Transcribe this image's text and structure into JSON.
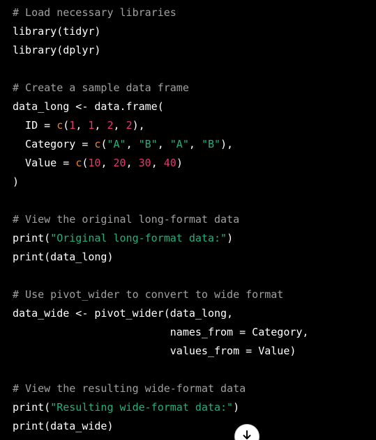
{
  "code_lines": [
    [
      {
        "t": "# Load necessary libraries",
        "k": "comment"
      }
    ],
    [
      {
        "t": "library(tidyr)",
        "k": "plain"
      }
    ],
    [
      {
        "t": "library(dplyr)",
        "k": "plain"
      }
    ],
    [],
    [
      {
        "t": "# Create a sample data frame",
        "k": "comment"
      }
    ],
    [
      {
        "t": "data_long <- data.frame(",
        "k": "plain"
      }
    ],
    [
      {
        "t": "  ID = ",
        "k": "plain"
      },
      {
        "t": "c",
        "k": "fn"
      },
      {
        "t": "(",
        "k": "plain"
      },
      {
        "t": "1",
        "k": "num"
      },
      {
        "t": ", ",
        "k": "plain"
      },
      {
        "t": "1",
        "k": "num"
      },
      {
        "t": ", ",
        "k": "plain"
      },
      {
        "t": "2",
        "k": "num"
      },
      {
        "t": ", ",
        "k": "plain"
      },
      {
        "t": "2",
        "k": "num"
      },
      {
        "t": "),",
        "k": "plain"
      }
    ],
    [
      {
        "t": "  Category = ",
        "k": "plain"
      },
      {
        "t": "c",
        "k": "fn"
      },
      {
        "t": "(",
        "k": "plain"
      },
      {
        "t": "\"A\"",
        "k": "str"
      },
      {
        "t": ", ",
        "k": "plain"
      },
      {
        "t": "\"B\"",
        "k": "str"
      },
      {
        "t": ", ",
        "k": "plain"
      },
      {
        "t": "\"A\"",
        "k": "str"
      },
      {
        "t": ", ",
        "k": "plain"
      },
      {
        "t": "\"B\"",
        "k": "str"
      },
      {
        "t": "),",
        "k": "plain"
      }
    ],
    [
      {
        "t": "  Value = ",
        "k": "plain"
      },
      {
        "t": "c",
        "k": "fn"
      },
      {
        "t": "(",
        "k": "plain"
      },
      {
        "t": "10",
        "k": "num"
      },
      {
        "t": ", ",
        "k": "plain"
      },
      {
        "t": "20",
        "k": "num"
      },
      {
        "t": ", ",
        "k": "plain"
      },
      {
        "t": "30",
        "k": "num"
      },
      {
        "t": ", ",
        "k": "plain"
      },
      {
        "t": "40",
        "k": "num"
      },
      {
        "t": ")",
        "k": "plain"
      }
    ],
    [
      {
        "t": ")",
        "k": "plain"
      }
    ],
    [],
    [
      {
        "t": "# View the original long-format data",
        "k": "comment"
      }
    ],
    [
      {
        "t": "print(",
        "k": "plain"
      },
      {
        "t": "\"Original long-format data:\"",
        "k": "str"
      },
      {
        "t": ")",
        "k": "plain"
      }
    ],
    [
      {
        "t": "print(data_long)",
        "k": "plain"
      }
    ],
    [],
    [
      {
        "t": "# Use pivot_wider to convert to wide format",
        "k": "comment"
      }
    ],
    [
      {
        "t": "data_wide <- pivot_wider(data_long,",
        "k": "plain"
      }
    ],
    [
      {
        "t": "                         names_from = Category,",
        "k": "plain"
      }
    ],
    [
      {
        "t": "                         values_from = Value)",
        "k": "plain"
      }
    ],
    [],
    [
      {
        "t": "# View the resulting wide-format data",
        "k": "comment"
      }
    ],
    [
      {
        "t": "print(",
        "k": "plain"
      },
      {
        "t": "\"Resulting wide-format data:\"",
        "k": "str"
      },
      {
        "t": ")",
        "k": "plain"
      }
    ],
    [
      {
        "t": "print(data_wide)",
        "k": "plain"
      }
    ]
  ],
  "scroll_button": {
    "icon": "arrow-down-icon"
  },
  "colors": {
    "background": "#000000",
    "plain": "#ffffff",
    "comment": "#a0a0a0",
    "number": "#e3386e",
    "string": "#22b083",
    "function": "#e8842c"
  }
}
